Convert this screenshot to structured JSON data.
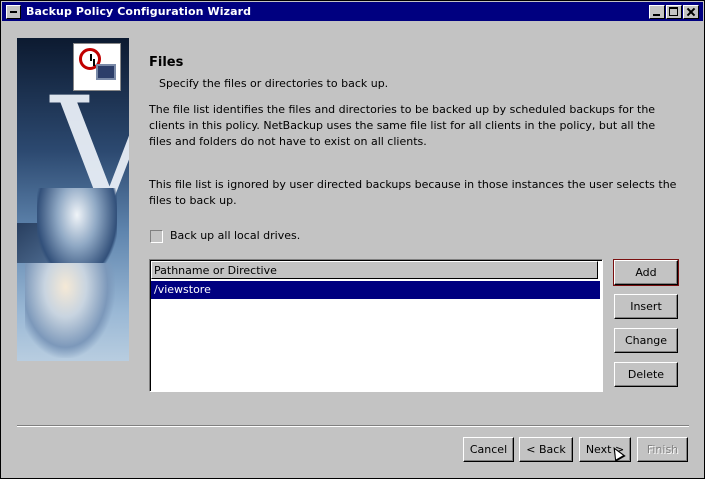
{
  "window": {
    "title": "Backup Policy Configuration Wizard"
  },
  "page": {
    "heading": "Files",
    "subheading": "Specify the files or directories to back up.",
    "paragraph1": "The file list identifies the files and directories to be backed up by scheduled backups for the clients in this policy. NetBackup uses the same file list for all clients in the policy, but all the files and folders do not have to exist on all clients.",
    "paragraph2": "This file list is ignored by user directed backups because in those instances the user selects the files to back up."
  },
  "checkbox": {
    "label": "Back up all local drives.",
    "checked": false
  },
  "file_list": {
    "column_header": "Pathname or Directive",
    "rows": [
      "/viewstore"
    ],
    "selected_index": 0
  },
  "side_buttons": {
    "add": "Add",
    "insert": "Insert",
    "change": "Change",
    "delete": "Delete"
  },
  "nav_buttons": {
    "cancel": "Cancel",
    "back": "< Back",
    "next": "Next >",
    "finish": "Finish"
  },
  "icons": {
    "logo": "clock-monitor-icon",
    "system_menu": "system-menu-icon",
    "minimize": "minimize-icon",
    "maximize": "maximize-icon",
    "close": "close-icon"
  },
  "colors": {
    "titlebar": "#000080",
    "selection": "#000080",
    "background": "#c3c3c3"
  }
}
